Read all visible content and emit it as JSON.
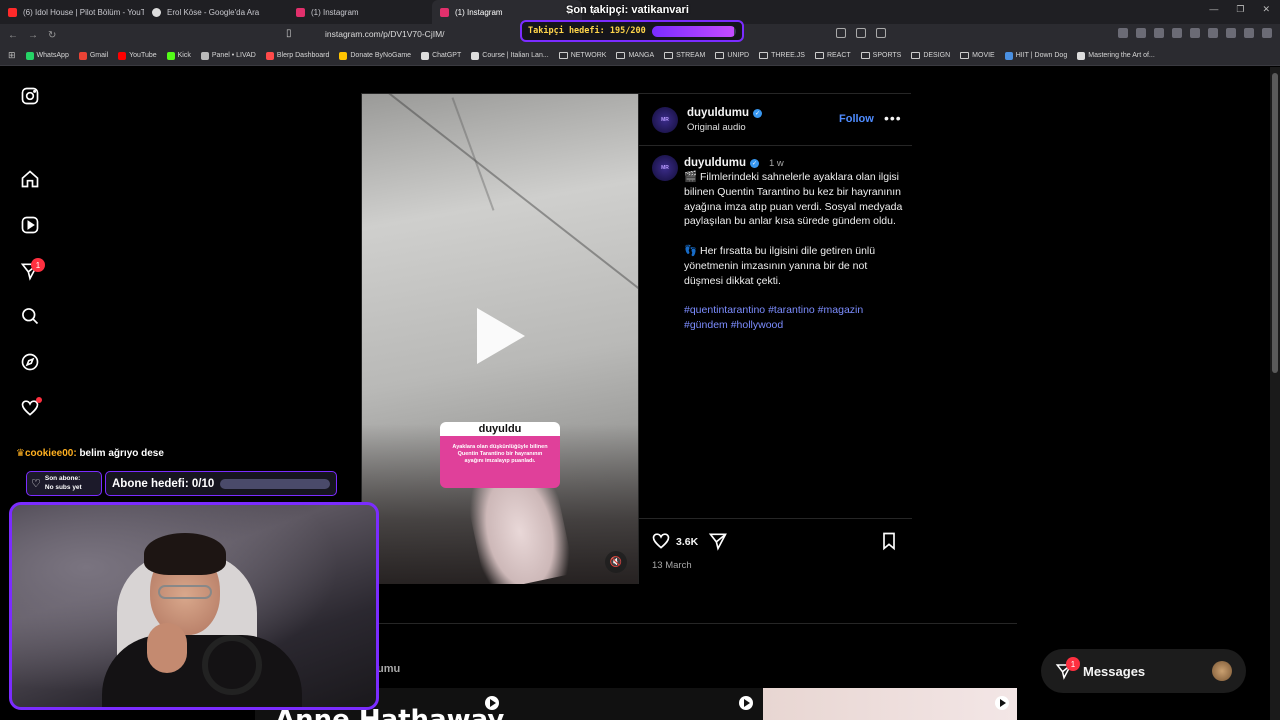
{
  "browser": {
    "tabs": [
      {
        "title": "(6) Idol House | Pilot Bölüm - YouTub",
        "color": "#ff2a2a",
        "active": false
      },
      {
        "title": "Erol Köse - Google'da Ara",
        "color": "#dddddd",
        "active": false
      },
      {
        "title": "(1) Instagram",
        "color": "#e1306c",
        "active": false
      },
      {
        "title": "(1) Instagram",
        "color": "#e1306c",
        "active": true
      }
    ],
    "url": "instagram.com/p/DV1V70-CjIM/",
    "bookmarks": [
      {
        "label": "WhatsApp",
        "color": "#25d366"
      },
      {
        "label": "Gmail",
        "color": "#ea4335"
      },
      {
        "label": "YouTube",
        "color": "#ff0000"
      },
      {
        "label": "Kick",
        "color": "#53fc18"
      },
      {
        "label": "Panel • LIVAD",
        "color": "#bbbbbb"
      },
      {
        "label": "Blerp Dashboard",
        "color": "#ff4a4a"
      },
      {
        "label": "Donate ByNoGame",
        "color": "#ffc400"
      },
      {
        "label": "ChatGPT",
        "color": "#dddddd"
      },
      {
        "label": "Course | Italian Lan...",
        "color": "#dddddd"
      },
      {
        "label": "NETWORK",
        "folder": true
      },
      {
        "label": "MANGA",
        "folder": true
      },
      {
        "label": "STREAM",
        "folder": true
      },
      {
        "label": "UNIPD",
        "folder": true
      },
      {
        "label": "THREE.JS",
        "folder": true
      },
      {
        "label": "REACT",
        "folder": true
      },
      {
        "label": "SPORTS",
        "folder": true
      },
      {
        "label": "DESIGN",
        "folder": true
      },
      {
        "label": "MOVIE",
        "folder": true
      },
      {
        "label": "HIIT | Down Dog",
        "color": "#4a90e2"
      },
      {
        "label": "Mastering the Art of...",
        "color": "#dddddd"
      }
    ]
  },
  "overlay": {
    "follower_goal_title": "Son takipçi: vatikanvari",
    "follower_goal_label": "Takipçi hedefi: 195/200",
    "follower_goal_progress": 0.975,
    "chat_user": "cookiee00:",
    "chat_message": "belim ağrıyo dese",
    "last_sub_label": "Son abone:",
    "last_sub_value": "No subs yet",
    "sub_goal_label": "Abone hedefi: 0/10",
    "sub_goal_progress": 0.0,
    "accent": "#7b2cff"
  },
  "instagram": {
    "nav": {
      "notifications_badge": "1",
      "activity_dot": true
    },
    "post": {
      "username": "duyuldumu",
      "audio": "Original audio",
      "follow_label": "Follow",
      "more_label": "•••",
      "caption_user": "duyuldumu",
      "caption_time": "1 w",
      "caption_p1": "🎬 Filmlerindeki sahnelerle ayaklara olan ilgisi bilinen Quentin Tarantino bu kez bir hayranının ayağına imza atıp puan verdi. Sosyal medyada paylaşılan bu anlar kısa sürede gündem oldu.",
      "caption_p2": "👣 Her fırsatta bu ilgisini dile getiren ünlü yönetmenin imzasının yanına bir de not düşmesi dikkat çekti.",
      "hashtags": "#quentintarantino #tarantino #magazin #gündem #hollywood",
      "likes": "3.6K",
      "date": "13 March",
      "sticker_head": "duyuldu",
      "sticker_body": "Ayaklara olan düşkünlüğüyle bilinen Quentin Tarantino bir hayranının ayağını imzalayıp puanladı."
    },
    "more_from_label": "umu",
    "bottom_title": "Anne Hathaway",
    "messages_label": "Messages",
    "messages_badge": "1"
  }
}
